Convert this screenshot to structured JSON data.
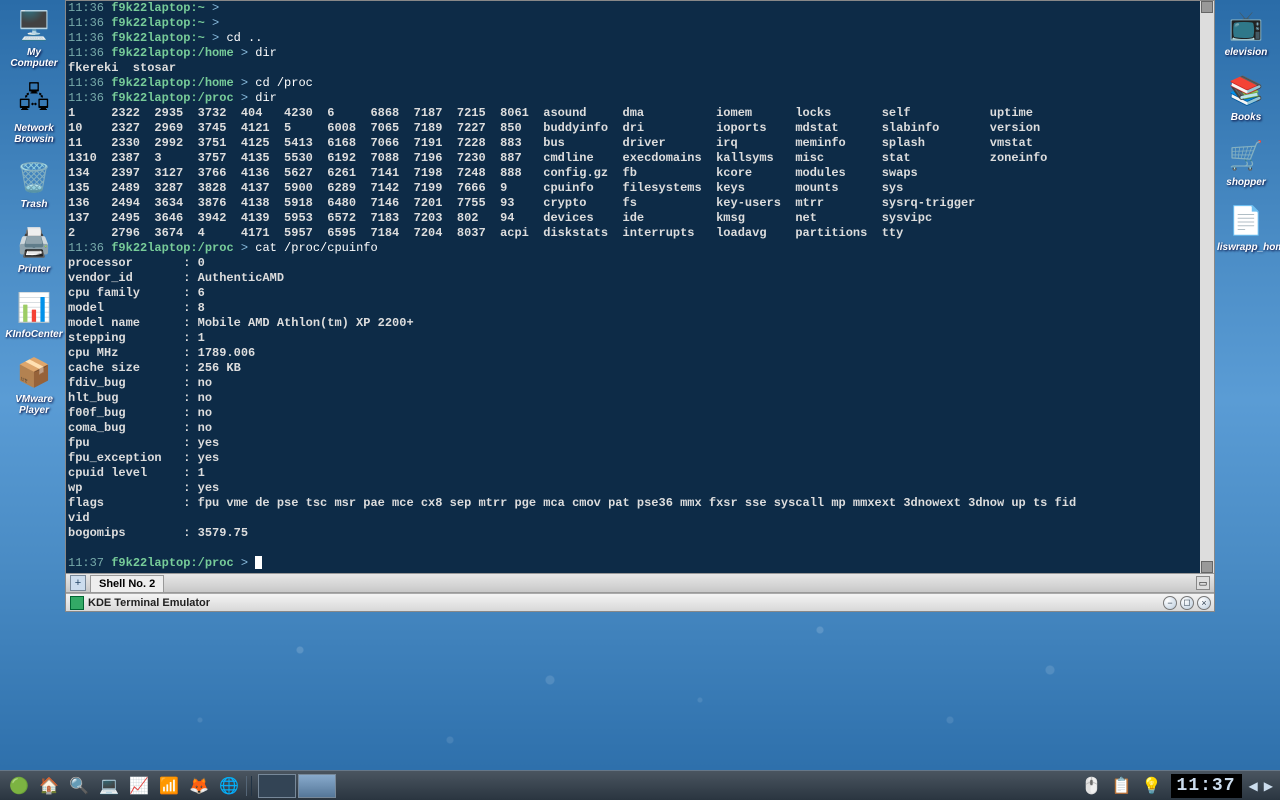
{
  "desktop_left": [
    {
      "name": "my-computer",
      "label": "My Computer",
      "glyph": "🖥️"
    },
    {
      "name": "network-browsing",
      "label": "Network Browsin",
      "glyph": "🖧"
    },
    {
      "name": "trash",
      "label": "Trash",
      "glyph": "🗑️"
    },
    {
      "name": "printer",
      "label": "Printer",
      "glyph": "🖨️"
    },
    {
      "name": "kinfocenter",
      "label": "KInfoCenter",
      "glyph": "📊"
    },
    {
      "name": "vmware-player",
      "label": "VMware Player",
      "glyph": "📦"
    }
  ],
  "desktop_right": [
    {
      "name": "television",
      "label": "elevision",
      "glyph": "📺"
    },
    {
      "name": "books",
      "label": "Books",
      "glyph": "📚"
    },
    {
      "name": "shopper",
      "label": "shopper",
      "glyph": "🛒"
    },
    {
      "name": "liswrapp",
      "label": "liswrapp_home...",
      "glyph": "📄"
    }
  ],
  "terminal": {
    "tab_label": "Shell No. 2",
    "title": "KDE Terminal Emulator",
    "prompts": [
      {
        "time": "11:36",
        "path": "f9k22laptop:~",
        "cmd": ""
      },
      {
        "time": "11:36",
        "path": "f9k22laptop:~",
        "cmd": ""
      },
      {
        "time": "11:36",
        "path": "f9k22laptop:~",
        "cmd": "cd .."
      },
      {
        "time": "11:36",
        "path": "f9k22laptop:/home",
        "cmd": "dir"
      }
    ],
    "dir_home_output": "fkereki  stosar",
    "prompt_cdproc": {
      "time": "11:36",
      "path": "f9k22laptop:/home",
      "cmd": "cd /proc"
    },
    "prompt_dirproc": {
      "time": "11:36",
      "path": "f9k22laptop:/proc",
      "cmd": "dir"
    },
    "proc_listing": [
      "1     2322  2935  3732  404   4230  6     6868  7187  7215  8061  asound     dma          iomem      locks       self           uptime",
      "10    2327  2969  3745  4121  5     6008  7065  7189  7227  850   buddyinfo  dri          ioports    mdstat      slabinfo       version",
      "11    2330  2992  3751  4125  5413  6168  7066  7191  7228  883   bus        driver       irq        meminfo     splash         vmstat",
      "1310  2387  3     3757  4135  5530  6192  7088  7196  7230  887   cmdline    execdomains  kallsyms   misc        stat           zoneinfo",
      "134   2397  3127  3766  4136  5627  6261  7141  7198  7248  888   config.gz  fb           kcore      modules     swaps",
      "135   2489  3287  3828  4137  5900  6289  7142  7199  7666  9     cpuinfo    filesystems  keys       mounts      sys",
      "136   2494  3634  3876  4138  5918  6480  7146  7201  7755  93    crypto     fs           key-users  mtrr        sysrq-trigger",
      "137   2495  3646  3942  4139  5953  6572  7183  7203  802   94    devices    ide          kmsg       net         sysvipc",
      "2     2796  3674  4     4171  5957  6595  7184  7204  8037  acpi  diskstats  interrupts   loadavg    partitions  tty"
    ],
    "prompt_cat": {
      "time": "11:36",
      "path": "f9k22laptop:/proc",
      "cmd": "cat /proc/cpuinfo"
    },
    "cpuinfo": [
      "processor       : 0",
      "vendor_id       : AuthenticAMD",
      "cpu family      : 6",
      "model           : 8",
      "model name      : Mobile AMD Athlon(tm) XP 2200+",
      "stepping        : 1",
      "cpu MHz         : 1789.006",
      "cache size      : 256 KB",
      "fdiv_bug        : no",
      "hlt_bug         : no",
      "f00f_bug        : no",
      "coma_bug        : no",
      "fpu             : yes",
      "fpu_exception   : yes",
      "cpuid level     : 1",
      "wp              : yes",
      "flags           : fpu vme de pse tsc msr pae mce cx8 sep mtrr pge mca cmov pat pse36 mmx fxsr sse syscall mp mmxext 3dnowext 3dnow up ts fid",
      "vid",
      "bogomips        : 3579.75"
    ],
    "final_prompt": {
      "time": "11:37",
      "path": "f9k22laptop:/proc"
    }
  },
  "taskbar": {
    "launchers": [
      {
        "name": "start-menu",
        "glyph": "🟢"
      },
      {
        "name": "home",
        "glyph": "🏠"
      },
      {
        "name": "find",
        "glyph": "🔍"
      },
      {
        "name": "terminal",
        "glyph": "💻"
      },
      {
        "name": "sysmon",
        "glyph": "📈"
      },
      {
        "name": "network",
        "glyph": "📶"
      },
      {
        "name": "firefox",
        "glyph": "🦊"
      },
      {
        "name": "browser",
        "glyph": "🌐"
      }
    ],
    "tray": [
      {
        "name": "mouse",
        "glyph": "🖱️"
      },
      {
        "name": "clipboard",
        "glyph": "📋"
      },
      {
        "name": "display",
        "glyph": "💡"
      }
    ],
    "clock": "11:37"
  }
}
